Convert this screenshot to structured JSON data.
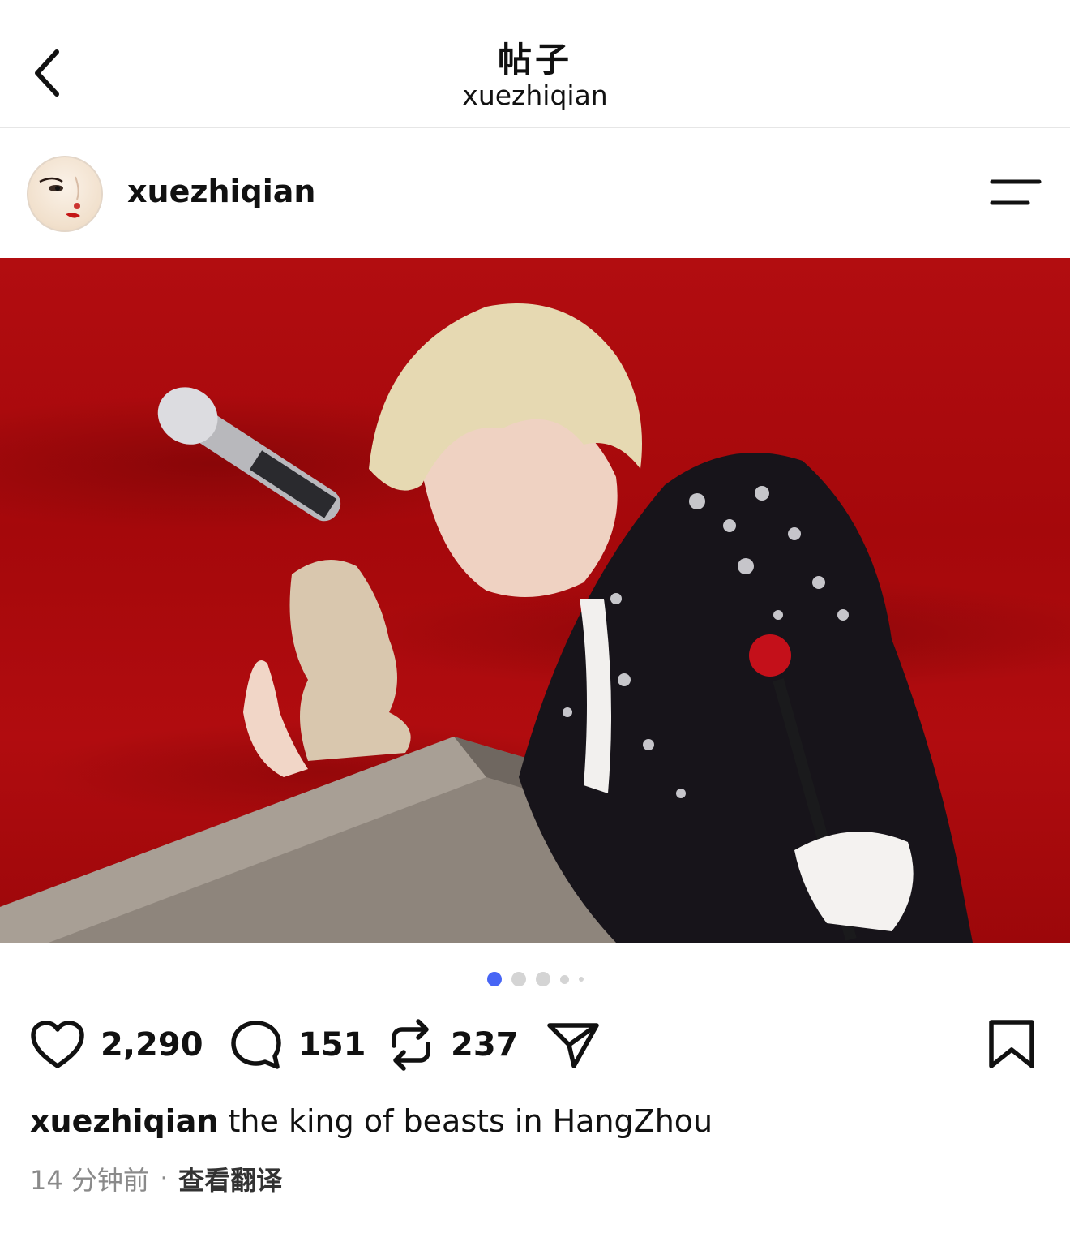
{
  "header": {
    "title": "帖子",
    "subtitle": "xuezhiqian"
  },
  "post": {
    "author": "xuezhiqian",
    "image_alt": "Performer with blond hair in jeweled black jacket beside a crystal microphone and eagle sculpture on stone podium, red backdrop",
    "carousel": {
      "count": 5,
      "active_index": 0
    },
    "actions": {
      "likes": "2,290",
      "comments": "151",
      "reposts": "237"
    },
    "caption": {
      "username": "xuezhiqian",
      "text": " the king of beasts in HangZhou"
    },
    "meta": {
      "time": "14 分钟前",
      "separator": "·",
      "translate_label": "查看翻译"
    }
  },
  "icons": {
    "back": "chevron-left-icon",
    "menu": "menu-icon",
    "like": "heart-icon",
    "comment": "comment-icon",
    "repost": "repost-icon",
    "share": "send-icon",
    "save": "bookmark-icon"
  },
  "colors": {
    "accent": "#4765f5",
    "background": "#ffffff",
    "text": "#111111",
    "muted": "#8a8a8a",
    "image_red": "#b20d10"
  }
}
